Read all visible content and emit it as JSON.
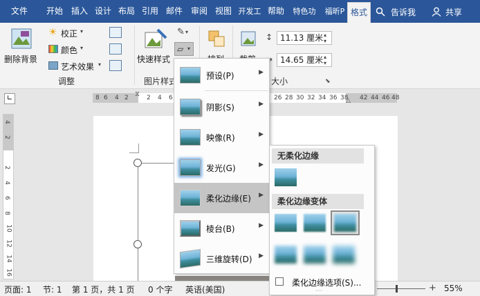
{
  "tabs": [
    "文件",
    "开始",
    "插入",
    "设计",
    "布局",
    "引用",
    "邮件",
    "审阅",
    "视图",
    "开发工",
    "帮助",
    "特色功",
    "福昕P",
    "格式"
  ],
  "tell_me": "告诉我",
  "share": "共享",
  "ribbon": {
    "remove_bg": "删除背景",
    "corrections": "校正",
    "color": "颜色",
    "art_effects": "艺术效果",
    "adjust_group": "调整",
    "quick_styles": "快速样式",
    "pic_styles_group": "图片样式",
    "arrange": "排列",
    "crop": "裁剪",
    "size_group": "大小",
    "height_value": "11.13 厘米",
    "width_value": "14.65 厘米"
  },
  "ruler": {
    "left_nums": [
      "8",
      "6",
      "4",
      "2"
    ],
    "mid_nums": [
      "2",
      "4",
      "6"
    ],
    "right_nums": [
      "26",
      "28",
      "30",
      "32",
      "34",
      "36",
      "38",
      "",
      "42",
      "44",
      "46",
      "48"
    ],
    "vert_nums": [
      "4",
      "2",
      "2",
      "4",
      "6",
      "8",
      "10",
      "12",
      "14",
      "16"
    ]
  },
  "effects_menu": [
    {
      "label": "预设(P)"
    },
    {
      "label": "阴影(S)"
    },
    {
      "label": "映像(R)"
    },
    {
      "label": "发光(G)"
    },
    {
      "label": "柔化边缘(E)"
    },
    {
      "label": "棱台(B)"
    },
    {
      "label": "三维旋转(D)"
    }
  ],
  "soft_edge": {
    "no_soft": "无柔化边缘",
    "variants": "柔化边缘变体",
    "options": "柔化边缘选项(S)..."
  },
  "status": {
    "page": "页面: 1",
    "section": "节: 1",
    "pages": "第 1 页，共 1 页",
    "words": "0 个字",
    "lang": "英语(美国)",
    "zoom": "55%"
  },
  "colors": {
    "accent": "#2b579a"
  }
}
